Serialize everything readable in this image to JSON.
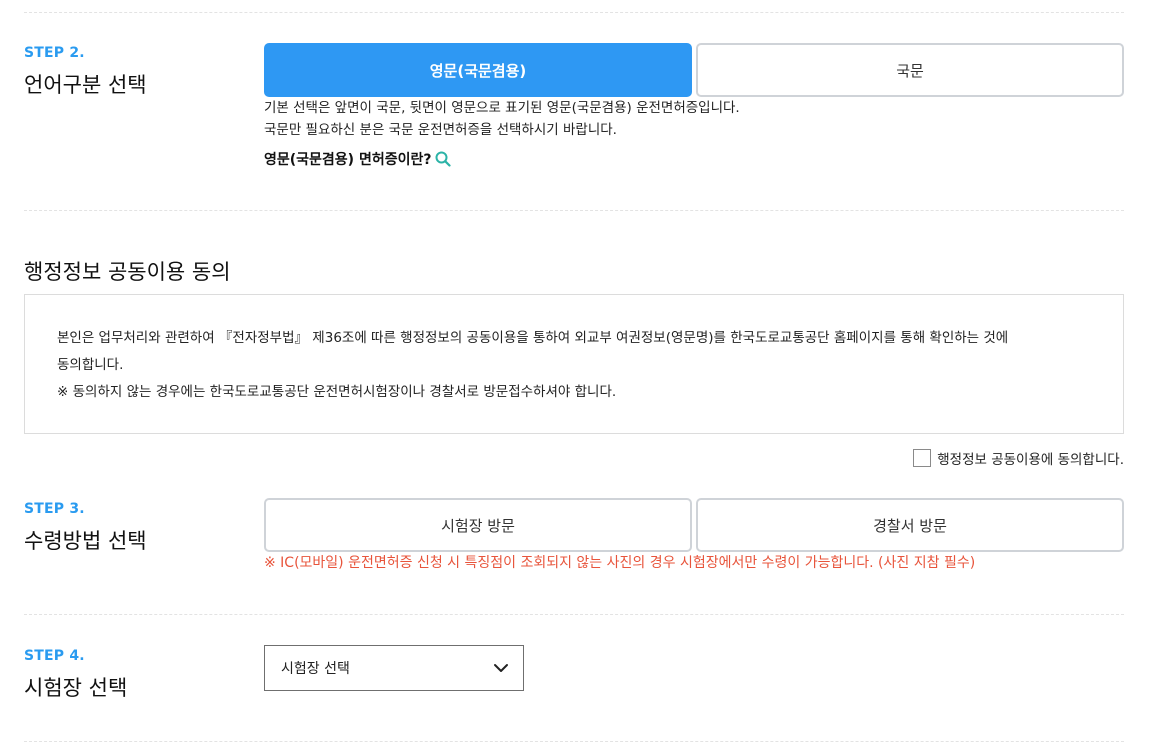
{
  "step2": {
    "step_label": "STEP 2.",
    "title": "언어구분 선택",
    "option_english": "영문(국문겸용)",
    "option_korean": "국문",
    "description_line1": "기본 선택은 앞면이 국문, 뒷면이 영문으로 표기된 영문(국문겸용) 운전면허증입니다.",
    "description_line2": "국문만 필요하신 분은 국문 운전면허증을 선택하시기 바랍니다.",
    "info_link": "영문(국문겸용) 면허증이란?",
    "info_icon": "search-icon"
  },
  "consent": {
    "title": "행정정보 공동이용 동의",
    "body_line1": "본인은 업무처리와 관련하여 『전자정부법』 제36조에 따른 행정정보의 공동이용을 통하여 외교부 여권정보(영문명)를 한국도로교통공단 홈페이지를 통해 확인하는 것에",
    "body_line2": "동의합니다.",
    "body_line3": "※ 동의하지 않는 경우에는 한국도로교통공단 운전면허시험장이나 경찰서로 방문접수하셔야 합니다.",
    "checkbox_label": "행정정보 공동이용에 동의합니다."
  },
  "step3": {
    "step_label": "STEP 3.",
    "title": "수령방법 선택",
    "option_test_center": "시험장 방문",
    "option_police": "경찰서 방문",
    "warning": "※ IC(모바일) 운전면허증 신청 시 특징점이 조회되지 않는 사진의 경우 시험장에서만 수령이 가능합니다. (사진 지참 필수)"
  },
  "step4": {
    "step_label": "STEP 4.",
    "title": "시험장 선택",
    "select_value": "시험장 선택",
    "select_icon": "chevron-down-icon"
  },
  "colors": {
    "accent": "#2e98f3",
    "step_label": "#2a9bf0",
    "warning": "#e8543b",
    "search_icon": "#2bb3a7"
  }
}
